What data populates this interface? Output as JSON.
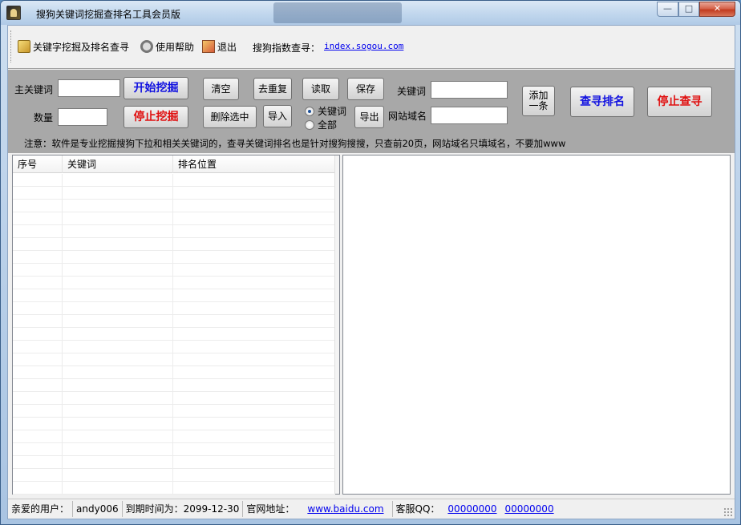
{
  "window": {
    "title": "搜狗关键词挖掘查排名工具会员版"
  },
  "window_controls": {
    "minimize": "—",
    "maximize": "□",
    "close": "✕"
  },
  "menu": {
    "items": [
      {
        "label": "关键字挖掘及排名查寻",
        "icon": "key-icon"
      },
      {
        "label": "使用帮助",
        "icon": "gear-icon"
      },
      {
        "label": "退出",
        "icon": "exit-icon"
      }
    ],
    "index_label": "搜狗指数查寻：",
    "index_link": "index.sogou.com"
  },
  "panel": {
    "main_keyword_label": "主关键词",
    "main_keyword_value": "",
    "count_label": "数量",
    "count_value": "",
    "start_button": "开始挖掘",
    "stop_button": "停止挖掘",
    "clear_button": "清空",
    "delete_selected_button": "删除选中",
    "dedupe_button": "去重复",
    "import_button": "导入",
    "read_button": "读取",
    "save_button": "保存",
    "export_button": "导出",
    "radio_keyword": "关键词",
    "radio_all": "全部",
    "radio_selected": "keyword",
    "keyword_label": "关键词",
    "keyword_value": "",
    "domain_label": "网站域名",
    "domain_value": "",
    "add_button_line1": "添加",
    "add_button_line2": "一条",
    "query_rank_button": "查寻排名",
    "stop_query_button": "停止查寻",
    "notice": "注意：软件是专业挖掘搜狗下拉和相关关键词的，查寻关键词排名也是针对搜狗搜搜，只查前20页，网站域名只填域名，不要加www"
  },
  "grid": {
    "columns": [
      "序号",
      "关键词",
      "排名位置"
    ],
    "rows": []
  },
  "status": {
    "user_label": "亲爱的用户：",
    "user_name": "andy006",
    "expire_label": "到期时间为：2099-12-30",
    "site_label": "官网地址：",
    "site_link": "www.baidu.com",
    "qq_label": "客服QQ：",
    "qq1": "00000000",
    "qq2": "00000000"
  }
}
